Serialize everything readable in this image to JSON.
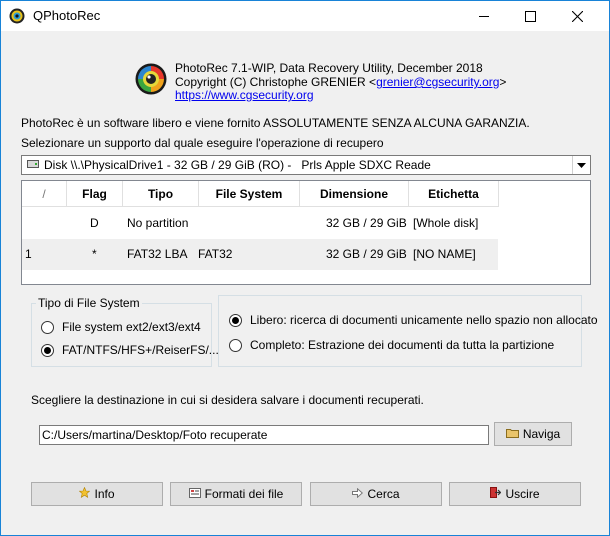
{
  "window": {
    "title": "QPhotoRec"
  },
  "header": {
    "line1": "PhotoRec 7.1-WIP, Data Recovery Utility, December 2018",
    "line2_prefix": "Copyright (C) Christophe GRENIER <",
    "email": "grenier@cgsecurity.org",
    "line2_suffix": ">",
    "website": "https://www.cgsecurity.org"
  },
  "intro": {
    "license_text": "PhotoRec è un software libero e viene fornito ASSOLUTAMENTE SENZA ALCUNA GARANZIA.",
    "select_label": "Selezionare un supporto dal quale eseguire l'operazione di recupero"
  },
  "disk_select": {
    "value": "Disk \\\\.\\PhysicalDrive1 - 32 GB / 29 GiB (RO) -   Prls Apple SDXC Reade"
  },
  "partition_table": {
    "columns": [
      "/",
      "Flag",
      "Tipo",
      "File System",
      "Dimensione",
      "Etichetta"
    ],
    "rows": [
      {
        "num": "",
        "flag": "D",
        "type": "No partition",
        "fs": "",
        "size": "32 GB / 29 GiB",
        "label": "[Whole disk]"
      },
      {
        "num": "1",
        "flag": "*",
        "type": "FAT32 LBA",
        "fs": "FAT32",
        "size": "32 GB / 29 GiB",
        "label": "[NO NAME]"
      }
    ]
  },
  "fs_type": {
    "legend": "Tipo di File System",
    "options": [
      "File system ext2/ext3/ext4",
      "FAT/NTFS/HFS+/ReiserFS/..."
    ],
    "selected": 1
  },
  "scope": {
    "options": [
      "Libero: ricerca di documenti unicamente nello spazio non allocato",
      "Completo: Estrazione dei documenti da tutta la partizione"
    ],
    "selected": 0
  },
  "destination": {
    "label": "Scegliere la destinazione in cui si desidera salvare i documenti recuperati.",
    "path": "C:/Users/martina/Desktop/Foto recuperate",
    "browse_label": "Naviga"
  },
  "buttons": {
    "info": "Info",
    "formats": "Formati dei file",
    "search": "Cerca",
    "exit": "Uscire"
  },
  "colors": {
    "window_border": "#1883d7",
    "link": "#0000ee",
    "background": "#f0f0f0"
  }
}
